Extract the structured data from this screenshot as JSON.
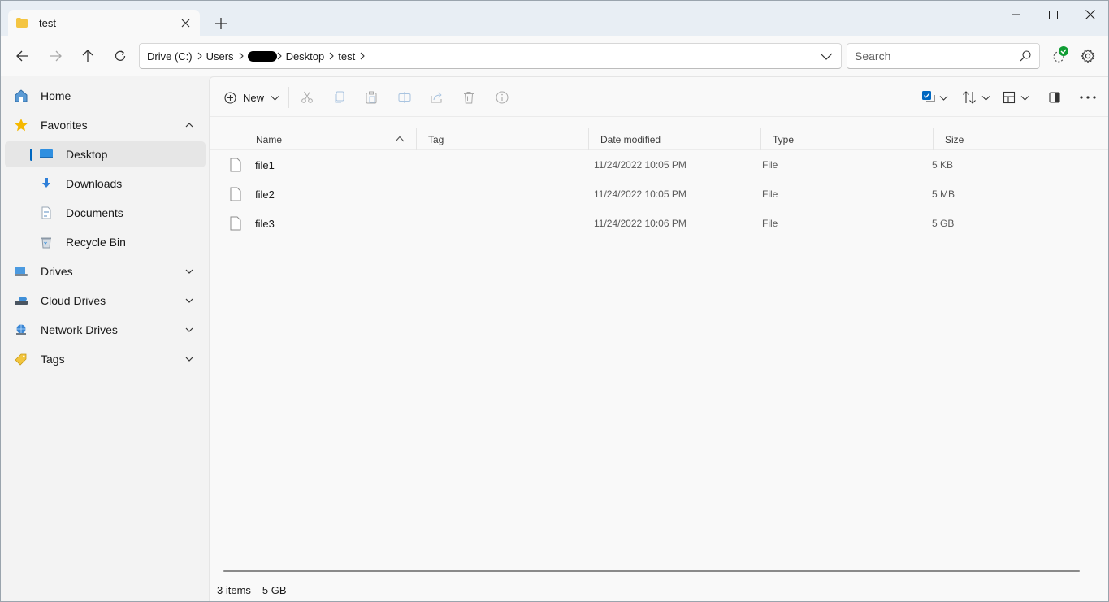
{
  "tab": {
    "title": "test"
  },
  "breadcrumb": {
    "items": [
      "Drive (C:)",
      "Users",
      "Desktop",
      "test"
    ]
  },
  "search": {
    "placeholder": "Search"
  },
  "sidebar": {
    "items": [
      {
        "label": "Home",
        "icon": "home-icon"
      },
      {
        "label": "Favorites",
        "icon": "star-icon"
      },
      {
        "label": "Desktop",
        "icon": "desktop-icon"
      },
      {
        "label": "Downloads",
        "icon": "download-icon"
      },
      {
        "label": "Documents",
        "icon": "documents-icon"
      },
      {
        "label": "Recycle Bin",
        "icon": "recycle-bin-icon"
      },
      {
        "label": "Drives",
        "icon": "drive-icon"
      },
      {
        "label": "Cloud Drives",
        "icon": "cloud-drive-icon"
      },
      {
        "label": "Network Drives",
        "icon": "network-drive-icon"
      },
      {
        "label": "Tags",
        "icon": "tag-icon"
      }
    ]
  },
  "toolbar": {
    "new_label": "New"
  },
  "columns": [
    "Name",
    "Tag",
    "Date modified",
    "Type",
    "Size"
  ],
  "files": [
    {
      "name": "file1",
      "date": "11/24/2022 10:05 PM",
      "type": "File",
      "size": "5 KB"
    },
    {
      "name": "file2",
      "date": "11/24/2022 10:05 PM",
      "type": "File",
      "size": "5 MB"
    },
    {
      "name": "file3",
      "date": "11/24/2022 10:06 PM",
      "type": "File",
      "size": "5 GB"
    }
  ],
  "status": {
    "items": "3 items",
    "size": "5 GB"
  },
  "colors": {
    "accent": "#0067c0",
    "status_ok": "#0f9d34",
    "folder": "#f4c542"
  }
}
